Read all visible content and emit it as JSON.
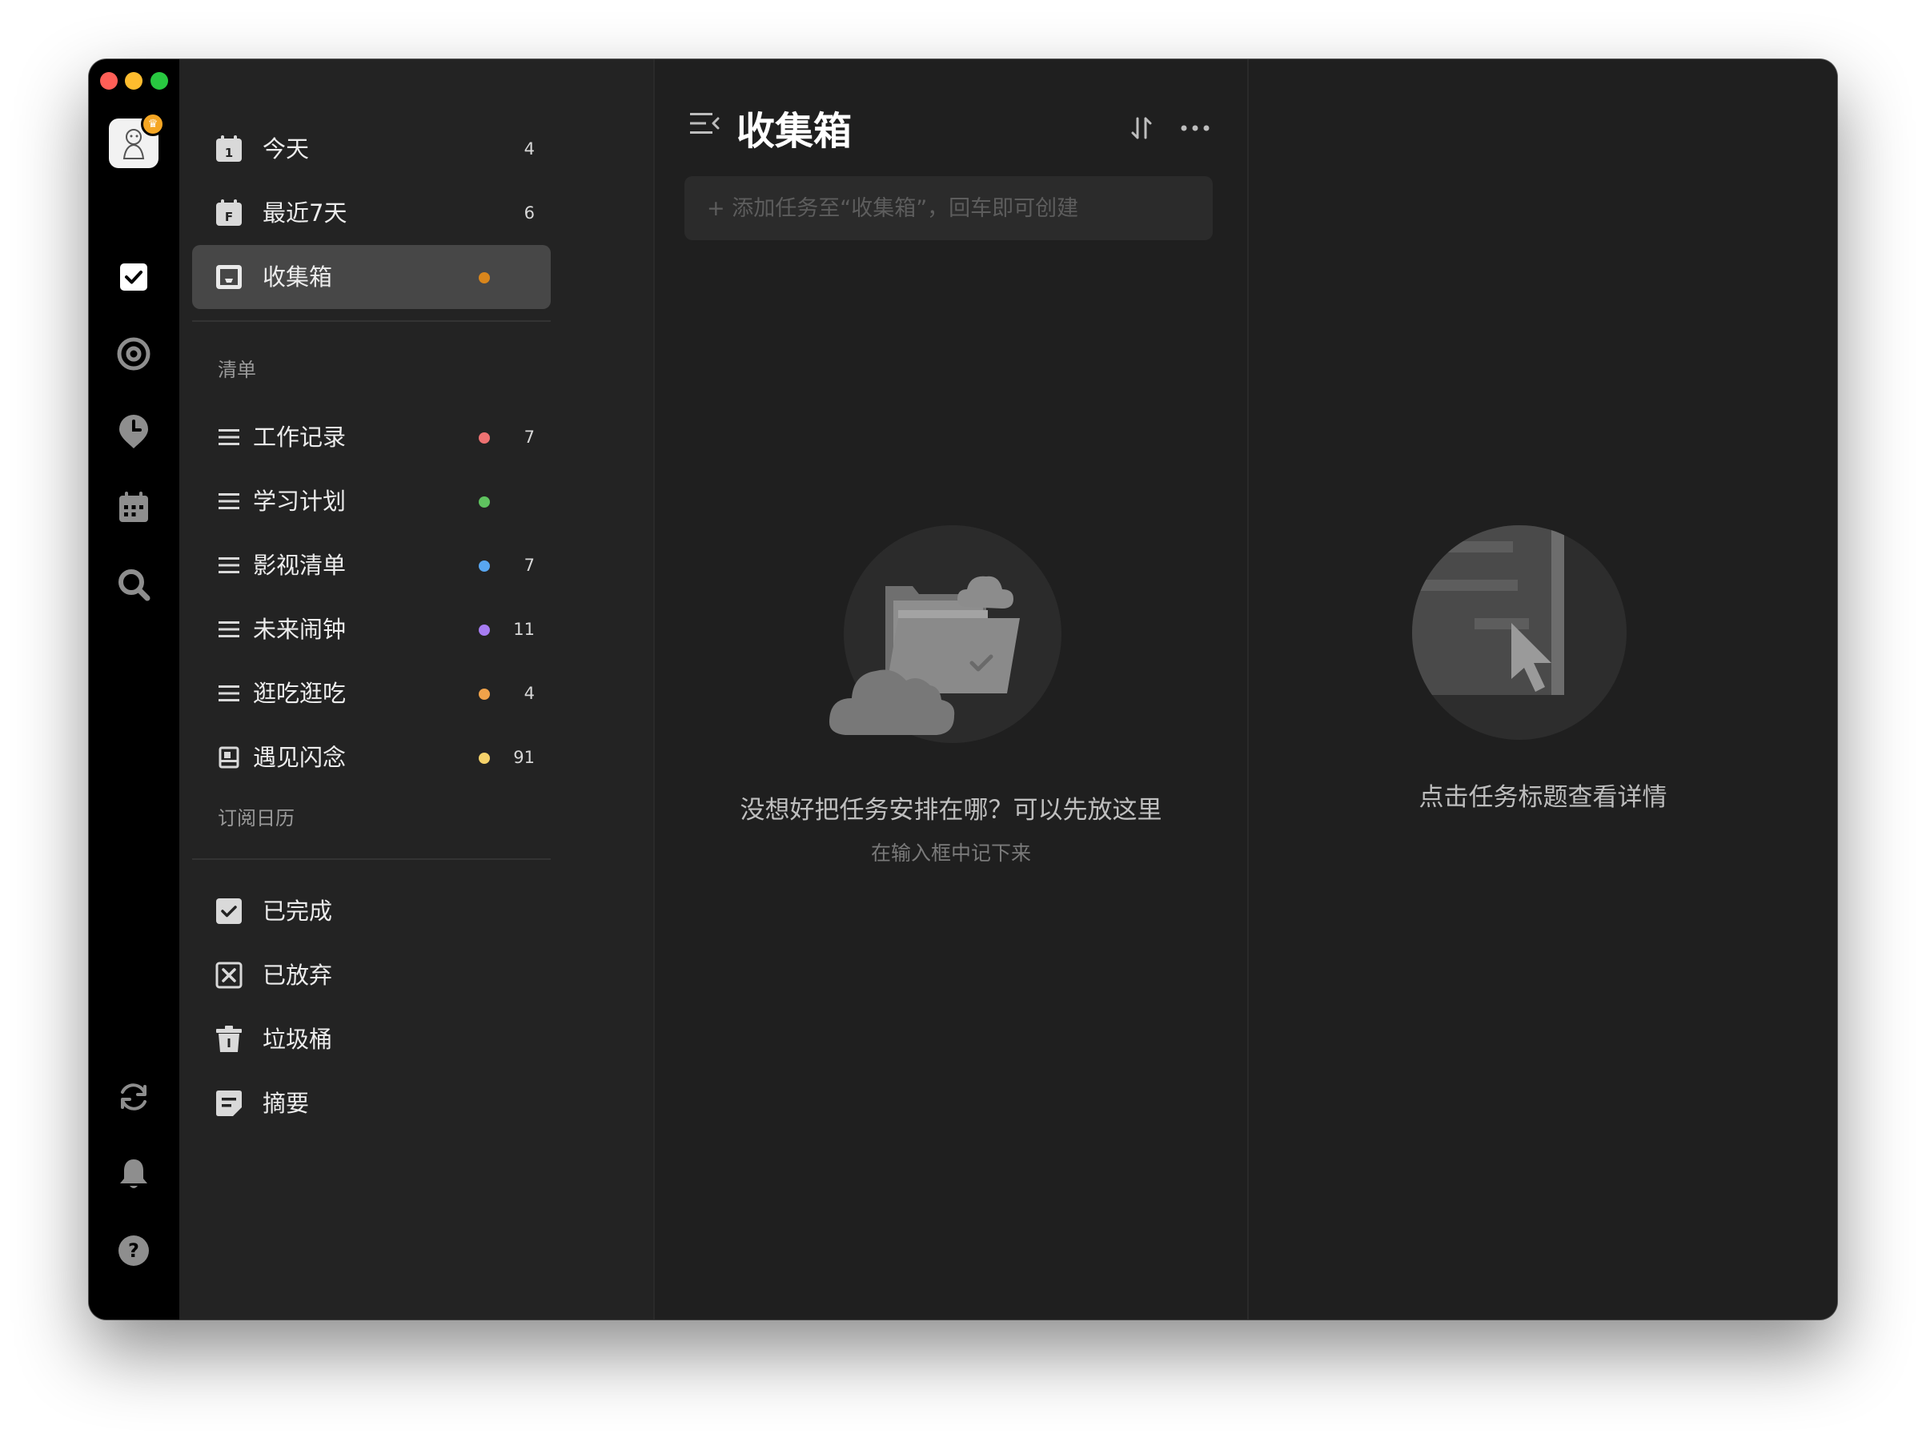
{
  "sidebar": {
    "smart_lists": [
      {
        "label": "今天",
        "count": "4",
        "icon": "calendar-day-icon",
        "icon_text": "1"
      },
      {
        "label": "最近7天",
        "count": "6",
        "icon": "calendar-week-icon",
        "icon_text": "F"
      },
      {
        "label": "收集箱",
        "count": "",
        "icon": "inbox-icon",
        "dot_color": "#d9861c",
        "active": true
      }
    ],
    "lists_title": "清单",
    "lists": [
      {
        "label": "工作记录",
        "count": "7",
        "dot_color": "#ee7272"
      },
      {
        "label": "学习计划",
        "count": "",
        "dot_color": "#5fc35f"
      },
      {
        "label": "影视清单",
        "count": "7",
        "dot_color": "#58a6f0"
      },
      {
        "label": "未来闹钟",
        "count": "11",
        "dot_color": "#a67cf2"
      },
      {
        "label": "逛吃逛吃",
        "count": "4",
        "dot_color": "#f0a24a"
      },
      {
        "label": "遇见闪念",
        "count": "91",
        "dot_color": "#f5d26a"
      }
    ],
    "calendar_title": "订阅日历",
    "system": [
      {
        "label": "已完成",
        "icon": "completed-checkbox-icon"
      },
      {
        "label": "已放弃",
        "icon": "abandoned-x-icon"
      },
      {
        "label": "垃圾桶",
        "icon": "trash-icon"
      },
      {
        "label": "摘要",
        "icon": "summary-icon"
      }
    ]
  },
  "main": {
    "title": "收集箱",
    "add_placeholder": "+ 添加任务至“收集箱”，回车即可创建",
    "empty_title": "没想好把任务安排在哪？可以先放这里",
    "empty_subtitle": "在输入框中记下来"
  },
  "detail": {
    "empty_text": "点击任务标题查看详情"
  },
  "avatar_badge": "♛"
}
